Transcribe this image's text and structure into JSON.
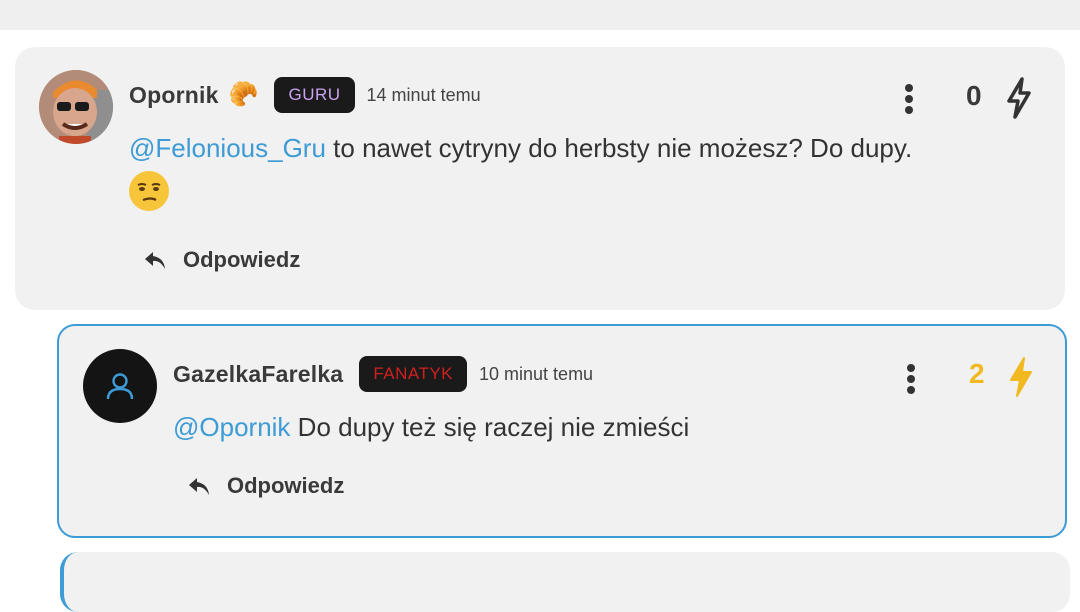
{
  "comments": [
    {
      "username": "Opornik",
      "flair_emoji": "🥐",
      "rank": "GURU",
      "timestamp": "14 minut temu",
      "score": "0",
      "mention": "@Felonious_Gru",
      "text": " to nawet cytryny do herbsty nie możesz? Do dupy.",
      "reply_label": "Odpowiedz",
      "avatar_icon": "avatar-photo",
      "body_emoji_icon": "unamused-face-emoji"
    },
    {
      "username": "GazelkaFarelka",
      "rank": "FANATYK",
      "timestamp": "10 minut temu",
      "score": "2",
      "mention": "@Opornik",
      "text": " Do dupy też się raczej nie zmieści",
      "reply_label": "Odpowiedz",
      "avatar_icon": "user-icon"
    }
  ],
  "colors": {
    "accent": "#3d9bd6",
    "score_positive": "#f2b820",
    "guru_rank": "#c9a3f0",
    "fanatyk_rank": "#d02020",
    "card_bg": "#f1f1f1"
  }
}
